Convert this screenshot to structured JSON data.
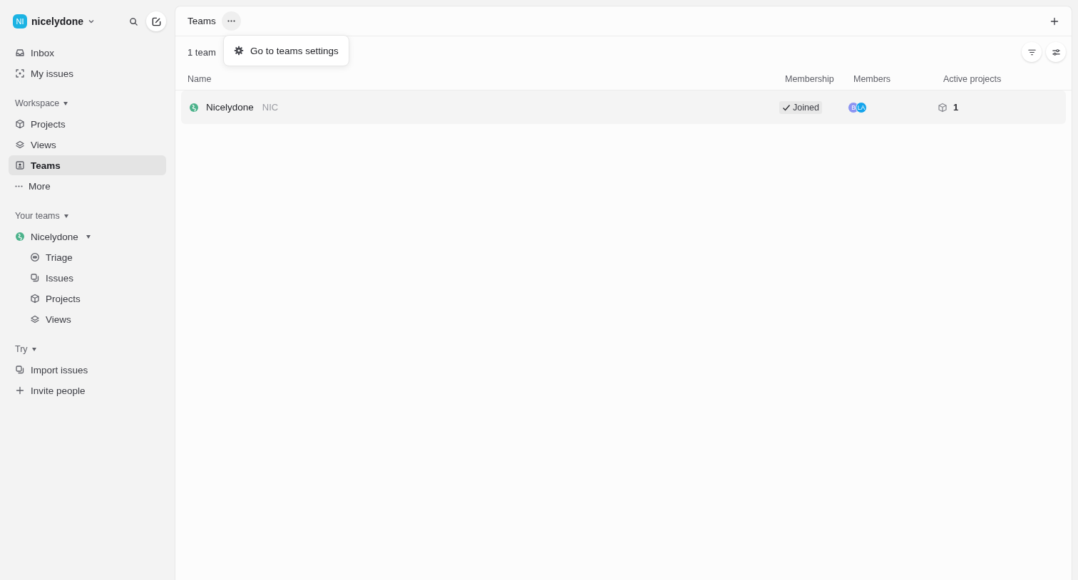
{
  "workspace": {
    "initials": "NI",
    "name": "nicelydone"
  },
  "sidebar": {
    "top_items": [
      {
        "label": "Inbox",
        "selected": false
      },
      {
        "label": "My issues",
        "selected": false
      }
    ],
    "sections": [
      {
        "title": "Workspace",
        "expanded": true,
        "items": [
          {
            "label": "Projects",
            "selected": false
          },
          {
            "label": "Views",
            "selected": false
          },
          {
            "label": "Teams",
            "selected": true
          },
          {
            "label": "More",
            "selected": false
          }
        ]
      },
      {
        "title": "Your teams",
        "expanded": true,
        "items": [
          {
            "label": "Nicelydone",
            "selected": false,
            "expanded": true,
            "children": [
              {
                "label": "Triage",
                "selected": false
              },
              {
                "label": "Issues",
                "selected": false
              },
              {
                "label": "Projects",
                "selected": false
              },
              {
                "label": "Views",
                "selected": false
              }
            ]
          }
        ]
      },
      {
        "title": "Try",
        "expanded": true,
        "items": [
          {
            "label": "Import issues",
            "selected": false
          },
          {
            "label": "Invite people",
            "selected": false
          }
        ]
      }
    ]
  },
  "header": {
    "title": "Teams",
    "menu": {
      "items": [
        "Go to teams settings"
      ]
    }
  },
  "toolbar": {
    "count": "1 team"
  },
  "table": {
    "columns": [
      "Name",
      "Membership",
      "Members",
      "Active projects"
    ],
    "rows": [
      {
        "name": "Nicelydone",
        "key": "NIC",
        "membership": "Joined",
        "members": [
          {
            "initials": "B",
            "color": "#8c94f2"
          },
          {
            "initials": "LA",
            "color": "#14a4ec"
          }
        ],
        "active_projects": "1"
      }
    ]
  }
}
